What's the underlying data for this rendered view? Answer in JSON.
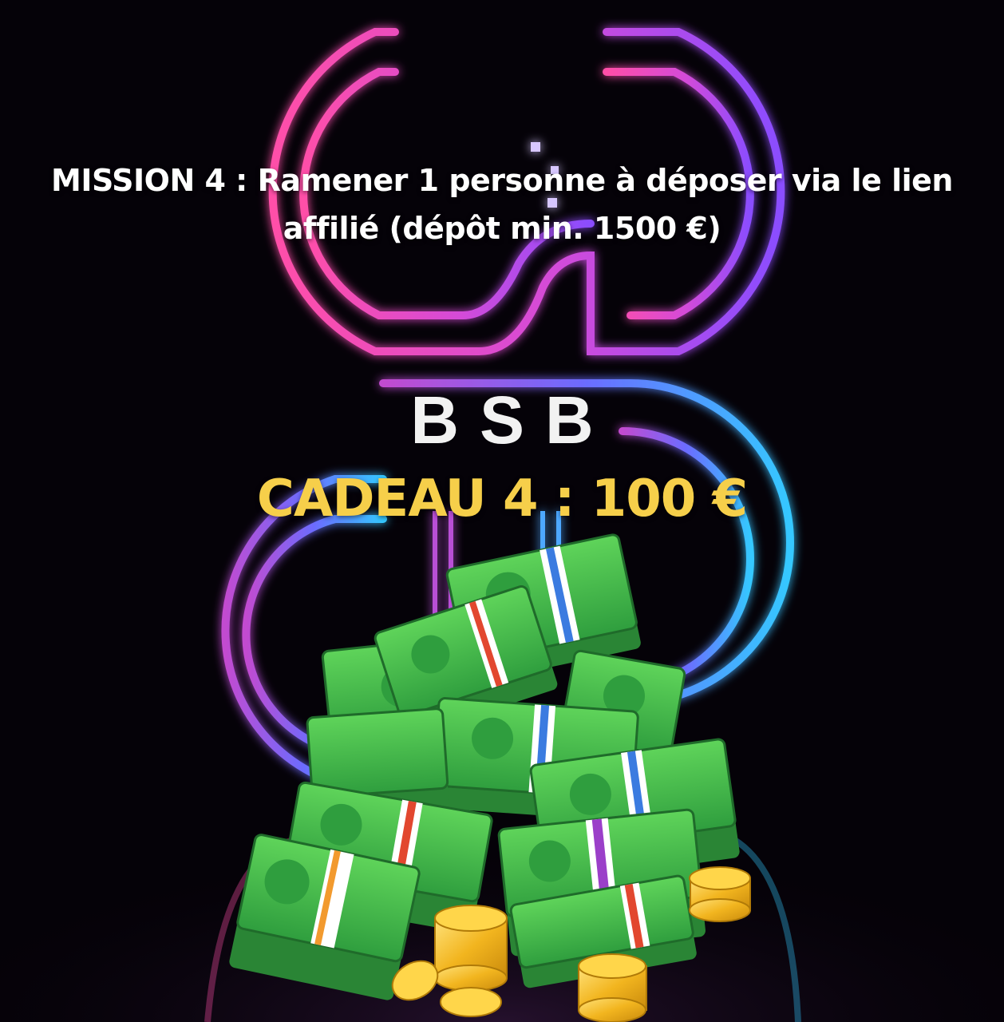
{
  "mission_text_line1": "MISSION 4 : Ramener 1 personne à déposer via le lien",
  "mission_text_line2": "affilié (dépôt min. 1500 €)",
  "brand_name": "BSB",
  "gift_text": "CADEAU 4 : 100 €",
  "colors": {
    "background": "#050208",
    "neon_pink": "#ff4fa8",
    "neon_purple": "#8a4dff",
    "neon_cyan": "#35c8ff",
    "gift_yellow": "#f6cf4a",
    "bill_green": "#37b24a"
  },
  "icons": [
    "neon-logo",
    "money-pile-icon",
    "coin-stack-icon"
  ]
}
